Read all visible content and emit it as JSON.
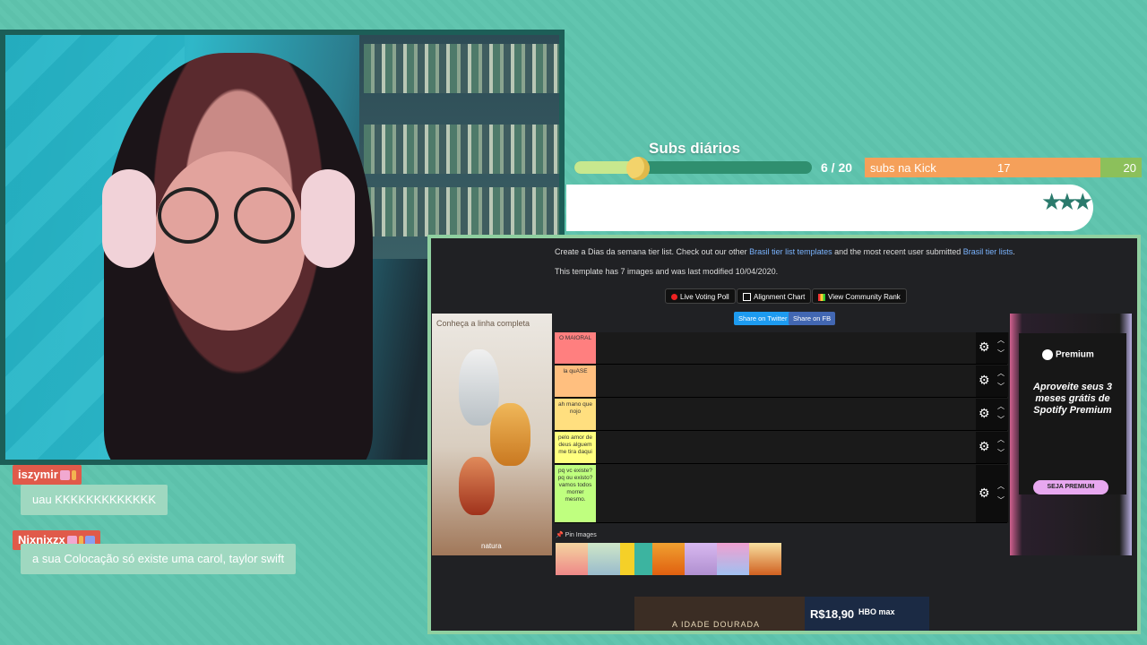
{
  "overlay": {
    "subs_title": "Subs diários",
    "subs_count": "6 / 20",
    "subs_progress": 0.3,
    "kick_label": "subs na Kick",
    "kick_value": "17",
    "kick_goal": "20",
    "kick_progress": 0.85
  },
  "browser": {
    "intro_prefix": "Create a Dias da semana tier list. Check out our other ",
    "intro_link1": "Brasil tier list templates",
    "intro_mid": " and the most recent user submitted ",
    "intro_link2": "Brasil tier lists",
    "intro_suffix": ".",
    "template_info": "This template has 7 images and was last modified 10/04/2020.",
    "buttons": {
      "live_poll": "Live Voting Poll",
      "alignment": "Alignment Chart",
      "community": "View Community Rank",
      "share_twitter": "Share on Twitter",
      "share_fb": "Share on FB"
    },
    "tiers": [
      {
        "label": "O MAIORAL",
        "color": "#ff7f7f"
      },
      {
        "label": "la quASE",
        "color": "#ffbf7f"
      },
      {
        "label": "ah mano que nojo",
        "color": "#ffdf7f"
      },
      {
        "label": "pelo amor de deus alguem me tira daqui",
        "color": "#ffff7f"
      },
      {
        "label": "pq vc existe?pq ou existo? vamos todos morrer mesmo.",
        "color": "#bfff7f"
      }
    ],
    "pin_label": "Pin Images",
    "ad_left_text": "Conheça a linha completa",
    "ad_left_brand": "natura",
    "ad_right_brand": "Premium",
    "ad_right_headline": "Aproveite seus 3 meses grátis de Spotify Premium",
    "ad_right_cta": "SEJA PREMIUM",
    "banner_title": "A IDADE DOURADA",
    "banner_price": "R$18,90",
    "banner_brand": "HBO max"
  },
  "chat": [
    {
      "user": "iszymir",
      "message": "uau KKKKKKKKKKKKK"
    },
    {
      "user": "Nixnixzx",
      "message": "a sua Colocação só existe uma carol, taylor swift"
    }
  ],
  "colors": {
    "accent": "#e05a4a",
    "bg": "#5fc3ad",
    "goal_fill": "#c7e88e",
    "kick": "#f5a05a"
  }
}
